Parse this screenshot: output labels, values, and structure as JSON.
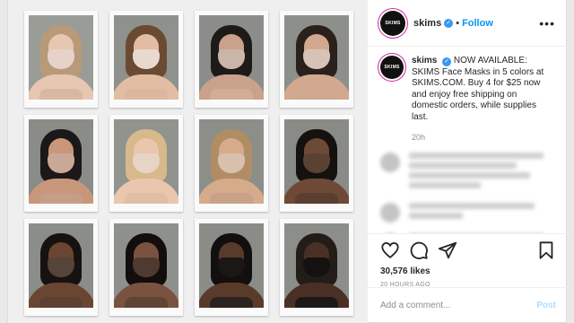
{
  "post": {
    "username": "skims",
    "avatar_text": "SKIMS",
    "follow_label": "Follow",
    "separator": "•",
    "more_label": "•••",
    "caption_user": "skims",
    "caption_body": "NOW AVAILABLE: SKIMS Face Masks in 5 colors at SKIMS.COM. Buy 4 for $25 now and enjoy free shipping on domestic orders, while supplies last.",
    "caption_time": "20h",
    "likes": "30,576 likes",
    "time_ago": "20 HOURS AGO",
    "comment_placeholder": "Add a comment...",
    "post_label": "Post"
  },
  "colors": {
    "verified": "#3897f0",
    "follow": "#0095f6",
    "story_ring": "#d6249f"
  },
  "photos": [
    {
      "bg": "#9a9c97",
      "hair": "#b89a78",
      "skin": "#e7c7b2",
      "mask": "#e6d2c8",
      "bra": "#d9b7a1"
    },
    {
      "bg": "#8f918c",
      "hair": "#6b4a33",
      "skin": "#e2bda3",
      "mask": "#e8d9cf",
      "bra": "#dbb79e"
    },
    {
      "bg": "#8b8d8a",
      "hair": "#1e1a18",
      "skin": "#caa18a",
      "mask": "#c9b6a8",
      "bra": "#d3ad96"
    },
    {
      "bg": "#8d8f8b",
      "hair": "#2a211c",
      "skin": "#d2a98f",
      "mask": "#d6c3b6",
      "bra": "#cfa88f"
    },
    {
      "bg": "#8a8c88",
      "hair": "#1b1817",
      "skin": "#c8977b",
      "mask": "#caa898",
      "bra": "#c89d85"
    },
    {
      "bg": "#91938f",
      "hair": "#d7b98c",
      "skin": "#e9c6ad",
      "mask": "#e8d4c6",
      "bra": "#e0bda5"
    },
    {
      "bg": "#8c8e8a",
      "hair": "#b08d63",
      "skin": "#d6ab8c",
      "mask": "#d9bfad",
      "bra": "#c8a287"
    },
    {
      "bg": "#898b87",
      "hair": "#15110f",
      "skin": "#6e4a36",
      "mask": "#5b4034",
      "bra": "#5a3e31"
    },
    {
      "bg": "#8b8d89",
      "hair": "#17120f",
      "skin": "#6a4632",
      "mask": "#56433a",
      "bra": "#5c4132"
    },
    {
      "bg": "#8e908c",
      "hair": "#120e0c",
      "skin": "#7a5340",
      "mask": "#4e3a31",
      "bra": "#604535"
    },
    {
      "bg": "#8a8c88",
      "hair": "#120f0e",
      "skin": "#5a3b2b",
      "mask": "#1a1715",
      "bra": "#2a2320"
    },
    {
      "bg": "#8c8e8a",
      "hair": "#241c18",
      "skin": "#4a3024",
      "mask": "#141211",
      "bra": "#1d1917"
    }
  ],
  "icons": {
    "like": "heart-icon",
    "comment": "comment-icon",
    "share": "share-icon",
    "save": "bookmark-icon",
    "more": "more-options-icon",
    "verified": "verified-badge-icon"
  }
}
